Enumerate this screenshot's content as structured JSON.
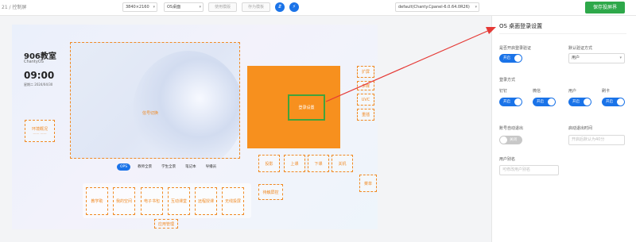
{
  "header": {
    "breadcrumb": "21 / 控制屏",
    "resolution": "3840×2160",
    "screen_mode": "OS桌面",
    "btn_disabled_1": "使用模版",
    "btn_disabled_2": "存为模板",
    "round_btn_1": "⇵",
    "round_btn_2": "⚡",
    "device_select": "default(Chanty.Cpanel-6.0.64.0R26)",
    "save_button": "保存投屏界"
  },
  "canvas": {
    "room_name": "906教室",
    "room_sub": "ChantyOS",
    "clock": "09:00",
    "date": "星期二  2024/04/30",
    "env_monitor": "环境概况",
    "env_sub": "—— ——",
    "signal_label": "信号切换",
    "tabs": [
      "OPS",
      "教师全景",
      "学生全景",
      "笔记本",
      "导播员"
    ],
    "right_blocks": [
      "扩屏",
      "多媒",
      "UVC",
      "重插"
    ],
    "orange_block_label": "登录设置",
    "power_buttons": [
      "投影",
      "上课",
      "下课",
      "关机"
    ],
    "menu_button": "菜单",
    "lock_button": "待触屏控",
    "app_buttons": [
      "教学助",
      "我的空间",
      "电子书包",
      "互动课堂",
      "远程授课",
      "无线投屏"
    ],
    "app_manage": "应用管理"
  },
  "settings_panel": {
    "title": "OS 桌面登录设置",
    "login_verify_label": "是否开启登录验证",
    "login_verify_state": "开启",
    "default_method_label": "默认验证方式",
    "default_method_value": "用户",
    "login_method_label": "登录方式",
    "methods": [
      {
        "name": "钉钉",
        "state": "开启"
      },
      {
        "name": "微信",
        "state": "开启"
      },
      {
        "name": "用户",
        "state": "开启"
      },
      {
        "name": "刷卡",
        "state": "开启"
      }
    ],
    "auto_logout_label": "账号自动退出",
    "auto_logout_state": "关闭",
    "auto_logout_time_label": "启动退出时间",
    "auto_logout_time_placeholder": "开启后默认为40分",
    "user_alias_label": "用户别名",
    "user_alias_placeholder": "可修改用户别名"
  },
  "colors": {
    "accent": "#1a73e8",
    "orange": "#f7901e",
    "dashed": "#f08a24",
    "save_green": "#2ea84a",
    "arrow_red": "#e53935"
  }
}
